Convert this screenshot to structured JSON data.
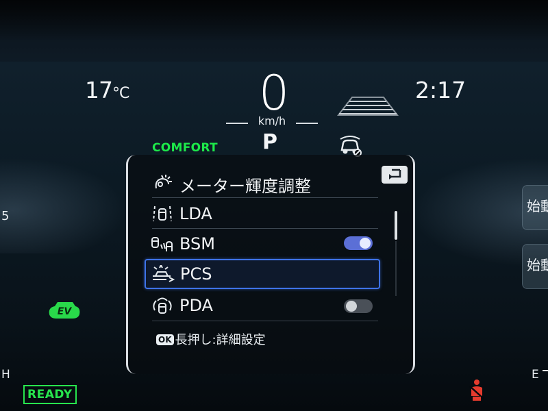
{
  "status": {
    "temperature": "17",
    "temperature_unit": "°C",
    "clock": "2:17",
    "speed": "0",
    "speed_unit": "km/h",
    "gear": "P",
    "drive_mode": "COMFORT",
    "ev_badge": "EV",
    "ready": "READY"
  },
  "gauges": {
    "left_number": "5",
    "fuel_full": "H",
    "fuel_empty": "E"
  },
  "side_buttons": [
    "始動",
    "始動"
  ],
  "menu": {
    "items": [
      {
        "label": "メーター輝度調整",
        "icon": "brightness-icon"
      },
      {
        "label": "LDA",
        "icon": "lane-departure-icon"
      },
      {
        "label": "BSM",
        "icon": "blind-spot-icon",
        "toggle": "on"
      },
      {
        "label": "PCS",
        "icon": "pre-collision-icon",
        "selected": true
      },
      {
        "label": "PDA",
        "icon": "proactive-driving-icon",
        "toggle": "off"
      }
    ],
    "hint_badge": "OK",
    "hint_text": "長押し:詳細設定"
  },
  "colors": {
    "accent_green": "#1de94a",
    "selection_blue": "#3e73e8",
    "toggle_on": "#5b6fd6",
    "warning_red": "#e53b2e"
  }
}
